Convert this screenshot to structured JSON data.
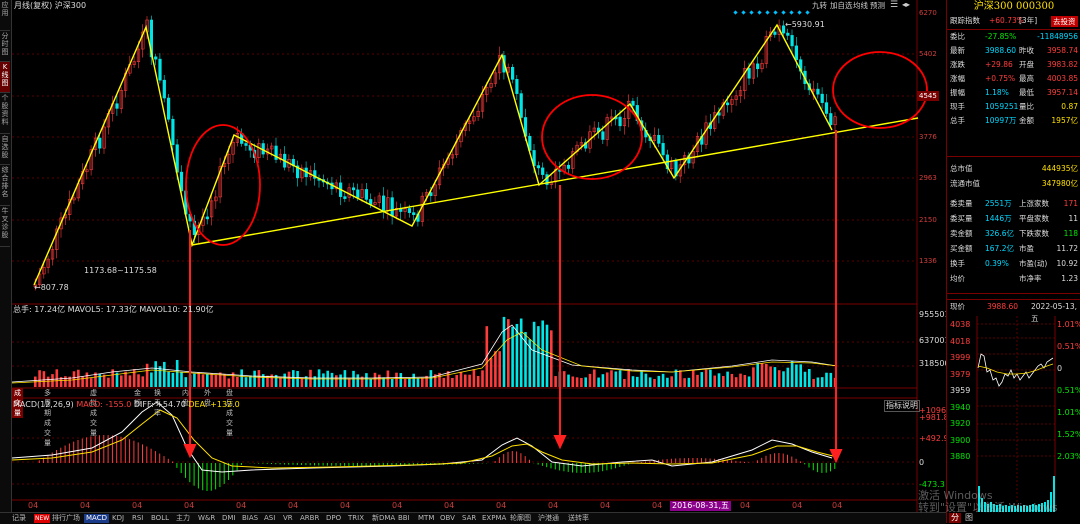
{
  "header": {
    "title": "月线(复权)  沪深300",
    "toolbar": [
      "九转",
      "加自选",
      "均线",
      "预测"
    ]
  },
  "left_sidebar": [
    "应用",
    "分时图",
    "K线图",
    "个股资料",
    "自选股",
    "综合排名",
    "牛叉诊股"
  ],
  "price_axis": [
    "6270",
    "5402",
    "4545",
    "3776",
    "2963",
    "2150",
    "1336"
  ],
  "price_axis_highlight": "4545",
  "annotations": {
    "high": "5930.91",
    "low": "807.78",
    "mid_label": "1173.68~1175.58"
  },
  "volume_panel": {
    "legend": "总手: 17.24亿 MAVOL5: 17.33亿 MAVOL10: 21.90亿",
    "axis": [
      "955501",
      "637001",
      "318500"
    ]
  },
  "indicator_tabs": [
    "成交量",
    "多周期成交量",
    "虚拟成交量",
    "金额",
    "换手率",
    "内盘",
    "外盘",
    "盘后成交量"
  ],
  "macd_panel": {
    "legend_prefix": "MACD(12,26,9)",
    "macd": "MACD: -155.0",
    "diff": "DIFF: +54.70",
    "dea": "DEA: +132.0",
    "axis": [
      "+1096",
      "+981.8",
      "+492.9",
      "0",
      "-473.3"
    ],
    "help": "指标说明"
  },
  "x_axis": [
    "04",
    "04",
    "04",
    "04",
    "04",
    "04",
    "04",
    "04",
    "04",
    "04",
    "04",
    "04",
    "04",
    "04",
    "04",
    "04"
  ],
  "cursor_date": "2016-08-31,五",
  "bottom_tabs": [
    "记录",
    "NEW",
    "排行广场",
    "MACD",
    "KDJ",
    "RSI",
    "BOLL",
    "主力",
    "W&R",
    "DMI",
    "BIAS",
    "ASI",
    "VR",
    "ARBR",
    "DPO",
    "TRIX",
    "新DMA",
    "BBI",
    "MTM",
    "OBV",
    "SAR",
    "EXPMA",
    "轮廓图",
    "沪港通",
    "送转率"
  ],
  "watermark": "激活 Windows\n转到\"设置\"以激活 Windows",
  "right_panel": {
    "title": "沪深300  000300",
    "index_label": "跟踪指数",
    "index_value": "+60.73%",
    "index_period": "[3年]",
    "index_btn": "去投资",
    "rows": [
      {
        "l": "委比",
        "lv": "-27.85%",
        "r": "",
        "rv": "-11848956"
      },
      {
        "l": "最新",
        "lv": "3988.60",
        "r": "昨收",
        "rv": "3958.74"
      },
      {
        "l": "涨跌",
        "lv": "+29.86",
        "r": "开盘",
        "rv": "3983.82"
      },
      {
        "l": "涨幅",
        "lv": "+0.75%",
        "r": "最高",
        "rv": "4003.85"
      },
      {
        "l": "振幅",
        "lv": "1.18%",
        "r": "最低",
        "rv": "3957.14"
      },
      {
        "l": "现手",
        "lv": "1059251",
        "r": "量比",
        "rv": "0.87"
      },
      {
        "l": "总手",
        "lv": "10997万",
        "r": "金额",
        "rv": "1957亿"
      },
      {
        "l": "总市值",
        "lv": "",
        "r": "",
        "rv": "444935亿"
      },
      {
        "l": "流通市值",
        "lv": "",
        "r": "",
        "rv": "347980亿"
      },
      {
        "l": "委卖量",
        "lv": "2551万",
        "r": "上涨家数",
        "rv": "171"
      },
      {
        "l": "委买量",
        "lv": "1446万",
        "r": "平盘家数",
        "rv": "11"
      },
      {
        "l": "卖金额",
        "lv": "326.6亿",
        "r": "下跌家数",
        "rv": "118"
      },
      {
        "l": "买金额",
        "lv": "167.2亿",
        "r": "市盈",
        "rv": "11.72"
      },
      {
        "l": "换手",
        "lv": "0.39%",
        "r": "市盈(动)",
        "rv": "10.92"
      },
      {
        "l": "均价",
        "lv": "",
        "r": "市净率",
        "rv": "1.23"
      }
    ],
    "intraday_label": "现价",
    "intraday_price": "3988.60",
    "intraday_date": "2022-05-13,五",
    "intraday_left_axis": [
      "4038",
      "4018",
      "3999",
      "3979",
      "3959",
      "3940",
      "3920",
      "3900",
      "3880"
    ],
    "intraday_right_axis": [
      "1.01%",
      "0.51%",
      "0",
      "0.51%",
      "1.01%",
      "1.52%",
      "2.03%"
    ],
    "intraday_tabs": [
      "分",
      "图"
    ]
  },
  "colors": {
    "up": "#ff3c3c",
    "down": "#00e5e5",
    "trendline": "#ffff00",
    "circle": "#ff0000"
  }
}
